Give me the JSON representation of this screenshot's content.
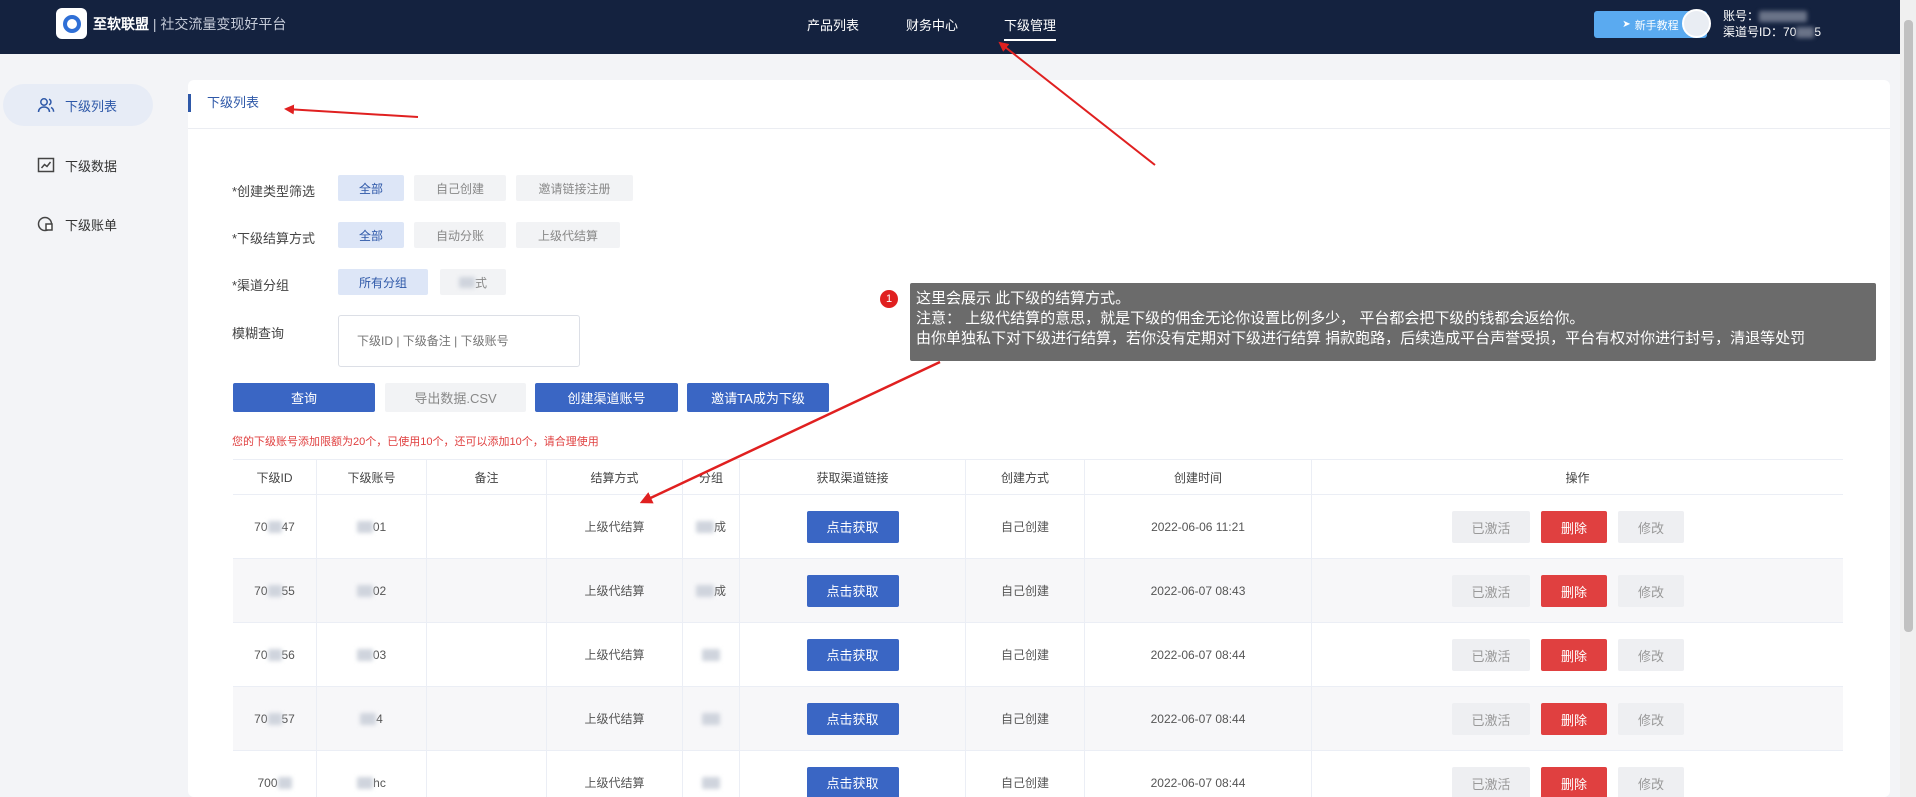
{
  "brand": {
    "name": "至软联盟",
    "separator": " | ",
    "slogan": "社交流量变现好平台"
  },
  "nav": {
    "items": [
      "产品列表",
      "财务中心",
      "下级管理"
    ],
    "active_index": 2
  },
  "header": {
    "tutorial_label": "新手教程",
    "account_label": "账号：",
    "channel_label": "渠道号ID：",
    "channel_id_start": "70",
    "channel_id_end": "5"
  },
  "sidebar": {
    "items": [
      {
        "label": "下级列表",
        "icon": "users-icon",
        "active": true
      },
      {
        "label": "下级数据",
        "icon": "data-chart-icon",
        "active": false
      },
      {
        "label": "下级账单",
        "icon": "bill-icon",
        "active": false
      }
    ]
  },
  "page": {
    "title": "下级列表"
  },
  "filters": {
    "create_type": {
      "label": "*创建类型筛选",
      "options": [
        "全部",
        "自己创建",
        "邀请链接注册"
      ],
      "selected": 0
    },
    "settle_mode": {
      "label": "*下级结算方式",
      "options": [
        "全部",
        "自动分账",
        "上级代结算"
      ],
      "selected": 0
    },
    "channel_group": {
      "label": "*渠道分组",
      "options": [
        "所有分组",
        "式"
      ],
      "selected": 0
    },
    "fuzzy": {
      "label": "模糊查询",
      "placeholder": "下级ID | 下级备注 | 下级账号"
    }
  },
  "actions": {
    "query": "查询",
    "export": "导出数据.CSV",
    "create": "创建渠道账号",
    "invite": "邀请TA成为下级"
  },
  "quota_notice": "您的下级账号添加限额为20个，已使用10个，还可以添加10个，请合理使用",
  "table": {
    "headers": [
      "下级ID",
      "下级账号",
      "备注",
      "结算方式",
      "分组",
      "获取渠道链接",
      "创建方式",
      "创建时间",
      "操作"
    ],
    "get_link_label": "点击获取",
    "op_labels": {
      "activated": "已激活",
      "delete": "删除",
      "edit": "修改"
    },
    "rows": [
      {
        "id_prefix": "70",
        "id_suffix": "47",
        "account_suffix": "01",
        "group_suffix": "成",
        "settle": "上级代结算",
        "created_by": "自己创建",
        "created_at": "2022-06-06 11:21"
      },
      {
        "id_prefix": "70",
        "id_suffix": "55",
        "account_suffix": "02",
        "group_suffix": "成",
        "settle": "上级代结算",
        "created_by": "自己创建",
        "created_at": "2022-06-07 08:43"
      },
      {
        "id_prefix": "70",
        "id_suffix": "56",
        "account_suffix": "03",
        "group_suffix": "",
        "settle": "上级代结算",
        "created_by": "自己创建",
        "created_at": "2022-06-07 08:44"
      },
      {
        "id_prefix": "70",
        "id_suffix": "57",
        "account_suffix": "4",
        "group_suffix": "",
        "settle": "上级代结算",
        "created_by": "自己创建",
        "created_at": "2022-06-07 08:44"
      },
      {
        "id_prefix": "700",
        "id_suffix": "",
        "account_suffix": "hc",
        "group_suffix": "",
        "settle": "上级代结算",
        "created_by": "自己创建",
        "created_at": "2022-06-07 08:44"
      }
    ]
  },
  "annotation": {
    "number": "1",
    "lines": [
      "这里会展示 此下级的结算方式。",
      "注意： 上级代结算的意思，就是下级的佣金无论你设置比例多少， 平台都会把下级的钱都会返给你。",
      "由你单独私下对下级进行结算，若你没有定期对下级进行结算 捐款跑路，后续造成平台声誉受损，平台有权对你进行封号，清退等处罚"
    ]
  },
  "colors": {
    "nav_bg": "#14223f",
    "primary": "#3a66c4",
    "danger": "#e04040",
    "accent": "#2e58a8",
    "annotation_bg": "#6b6b6b",
    "arrow": "#e02020"
  }
}
